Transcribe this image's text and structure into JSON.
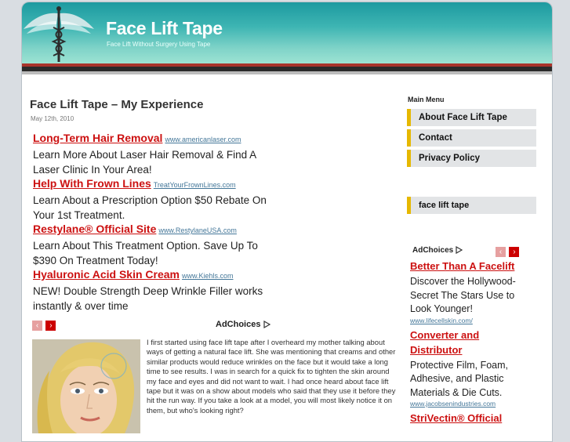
{
  "header": {
    "title": "Face Lift Tape",
    "tagline": "Face Lift Without Surgery Using Tape"
  },
  "post": {
    "title": "Face Lift Tape – My Experience",
    "date": "May 12th, 2010",
    "body": "I first started using face lift tape after I overheard my mother talking about ways of getting a natural face lift. She was mentioning that creams and other similar products would reduce wrinkles on the face but it would take a long time to see results. I was in search for a quick fix to tighten the skin around my face and eyes and did not want to wait. I had once heard about face lift tape but it was on a show about models who said that they use it before they hit the run way. If you take a look at a model, you will most likely notice it on them, but who's looking right?"
  },
  "ads": [
    {
      "title": "Long-Term Hair Removal",
      "url": "www.americanlaser.com",
      "desc": "Learn More About Laser Hair Removal & Find A Laser Clinic In Your Area!"
    },
    {
      "title": "Help With Frown Lines",
      "url": "TreatYourFrownLines.com",
      "desc": "Learn About a Prescription Option $50 Rebate On Your 1st Treatment."
    },
    {
      "title": "Restylane® Official Site",
      "url": "www.RestylaneUSA.com",
      "desc": "Learn About This Treatment Option. Save Up To $390 On Treatment Today!"
    },
    {
      "title": "Hyaluronic Acid Skin Cream",
      "url": "www.Kiehls.com",
      "desc": "NEW! Double Strength Deep Wrinkle Filler works instantly & over time"
    }
  ],
  "ad_nav": {
    "prev": "‹",
    "next": "›"
  },
  "adchoices_label": "AdChoices",
  "sidebar": {
    "menu_title": "Main Menu",
    "menu_items": [
      "About Face Lift Tape",
      "Contact",
      "Privacy Policy"
    ],
    "tag": "face lift tape"
  },
  "sidebar_ads": [
    {
      "title": "Better Than A Facelift",
      "desc": "Discover the Hollywood-Secret The Stars Use to Look Younger!",
      "url": "www.lifecellskin.com/"
    },
    {
      "title": "Converter and Distributor",
      "desc": "Protective Film, Foam, Adhesive, and Plastic Materials & Die Cuts.",
      "url": "www.jacobsenindustries.com"
    },
    {
      "title": "StriVectin® Official",
      "desc": "",
      "url": ""
    }
  ],
  "colors": {
    "header_teal": "#1d9aa0",
    "ad_title_red": "#cc1111",
    "menu_accent": "#e6b800"
  },
  "icons": {
    "logo": "caduceus-icon",
    "adchoices": "adchoices-triangle-icon"
  }
}
